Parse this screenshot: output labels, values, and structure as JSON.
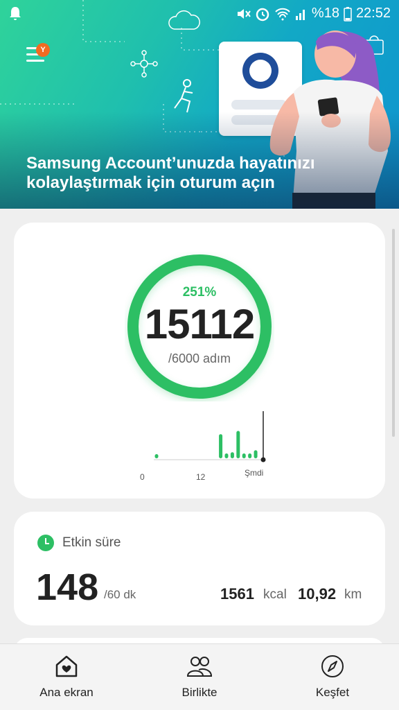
{
  "status_bar": {
    "battery_percent": "%18",
    "time": "22:52",
    "icons": [
      "notification-bell-icon",
      "mute-icon",
      "alarm-icon",
      "wifi-icon",
      "signal-icon",
      "battery-icon"
    ]
  },
  "banner": {
    "menu_badge": "Y",
    "title": "Samsung Account’unuzda hayatınızı kolaylaştırmak için oturum açın",
    "accent_color": "#1fbfae"
  },
  "steps": {
    "percent": "251%",
    "count": "15112",
    "goal": "/6000 adım",
    "progress": 2.51,
    "ring_color": "#2dbf64",
    "chart_data": {
      "type": "bar",
      "x_ticks": [
        "0",
        "12",
        "Şmdi"
      ],
      "hours": [
        0,
        1,
        2,
        3,
        4,
        5,
        6,
        7,
        8,
        9,
        10,
        11,
        12,
        13,
        14,
        15,
        16,
        17,
        18,
        19,
        20,
        21,
        22,
        23
      ],
      "values": [
        0.1,
        0,
        0,
        0,
        0,
        0,
        0,
        0,
        0,
        0,
        0,
        0.6,
        0.12,
        0.15,
        0.68,
        0.12,
        0.12,
        0.2,
        0,
        0,
        0,
        0,
        0,
        0
      ],
      "now_hour": 18.3
    }
  },
  "active": {
    "label": "Etkin süre",
    "minutes": "148",
    "goal": "/60 dk",
    "kcal_value": "1561",
    "kcal_unit": "kcal",
    "distance_value": "10,92",
    "distance_unit": "km"
  },
  "nav": {
    "items": [
      {
        "label": "Ana ekran",
        "icon": "home-icon"
      },
      {
        "label": "Birlikte",
        "icon": "people-icon"
      },
      {
        "label": "Keşfet",
        "icon": "compass-icon"
      }
    ]
  }
}
